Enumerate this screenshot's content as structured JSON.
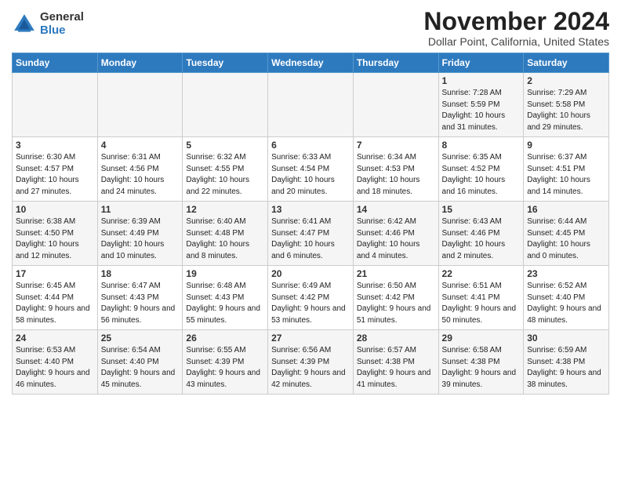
{
  "logo": {
    "general": "General",
    "blue": "Blue"
  },
  "title": "November 2024",
  "location": "Dollar Point, California, United States",
  "days_of_week": [
    "Sunday",
    "Monday",
    "Tuesday",
    "Wednesday",
    "Thursday",
    "Friday",
    "Saturday"
  ],
  "weeks": [
    [
      {
        "num": "",
        "info": ""
      },
      {
        "num": "",
        "info": ""
      },
      {
        "num": "",
        "info": ""
      },
      {
        "num": "",
        "info": ""
      },
      {
        "num": "",
        "info": ""
      },
      {
        "num": "1",
        "info": "Sunrise: 7:28 AM\nSunset: 5:59 PM\nDaylight: 10 hours and 31 minutes."
      },
      {
        "num": "2",
        "info": "Sunrise: 7:29 AM\nSunset: 5:58 PM\nDaylight: 10 hours and 29 minutes."
      }
    ],
    [
      {
        "num": "3",
        "info": "Sunrise: 6:30 AM\nSunset: 4:57 PM\nDaylight: 10 hours and 27 minutes."
      },
      {
        "num": "4",
        "info": "Sunrise: 6:31 AM\nSunset: 4:56 PM\nDaylight: 10 hours and 24 minutes."
      },
      {
        "num": "5",
        "info": "Sunrise: 6:32 AM\nSunset: 4:55 PM\nDaylight: 10 hours and 22 minutes."
      },
      {
        "num": "6",
        "info": "Sunrise: 6:33 AM\nSunset: 4:54 PM\nDaylight: 10 hours and 20 minutes."
      },
      {
        "num": "7",
        "info": "Sunrise: 6:34 AM\nSunset: 4:53 PM\nDaylight: 10 hours and 18 minutes."
      },
      {
        "num": "8",
        "info": "Sunrise: 6:35 AM\nSunset: 4:52 PM\nDaylight: 10 hours and 16 minutes."
      },
      {
        "num": "9",
        "info": "Sunrise: 6:37 AM\nSunset: 4:51 PM\nDaylight: 10 hours and 14 minutes."
      }
    ],
    [
      {
        "num": "10",
        "info": "Sunrise: 6:38 AM\nSunset: 4:50 PM\nDaylight: 10 hours and 12 minutes."
      },
      {
        "num": "11",
        "info": "Sunrise: 6:39 AM\nSunset: 4:49 PM\nDaylight: 10 hours and 10 minutes."
      },
      {
        "num": "12",
        "info": "Sunrise: 6:40 AM\nSunset: 4:48 PM\nDaylight: 10 hours and 8 minutes."
      },
      {
        "num": "13",
        "info": "Sunrise: 6:41 AM\nSunset: 4:47 PM\nDaylight: 10 hours and 6 minutes."
      },
      {
        "num": "14",
        "info": "Sunrise: 6:42 AM\nSunset: 4:46 PM\nDaylight: 10 hours and 4 minutes."
      },
      {
        "num": "15",
        "info": "Sunrise: 6:43 AM\nSunset: 4:46 PM\nDaylight: 10 hours and 2 minutes."
      },
      {
        "num": "16",
        "info": "Sunrise: 6:44 AM\nSunset: 4:45 PM\nDaylight: 10 hours and 0 minutes."
      }
    ],
    [
      {
        "num": "17",
        "info": "Sunrise: 6:45 AM\nSunset: 4:44 PM\nDaylight: 9 hours and 58 minutes."
      },
      {
        "num": "18",
        "info": "Sunrise: 6:47 AM\nSunset: 4:43 PM\nDaylight: 9 hours and 56 minutes."
      },
      {
        "num": "19",
        "info": "Sunrise: 6:48 AM\nSunset: 4:43 PM\nDaylight: 9 hours and 55 minutes."
      },
      {
        "num": "20",
        "info": "Sunrise: 6:49 AM\nSunset: 4:42 PM\nDaylight: 9 hours and 53 minutes."
      },
      {
        "num": "21",
        "info": "Sunrise: 6:50 AM\nSunset: 4:42 PM\nDaylight: 9 hours and 51 minutes."
      },
      {
        "num": "22",
        "info": "Sunrise: 6:51 AM\nSunset: 4:41 PM\nDaylight: 9 hours and 50 minutes."
      },
      {
        "num": "23",
        "info": "Sunrise: 6:52 AM\nSunset: 4:40 PM\nDaylight: 9 hours and 48 minutes."
      }
    ],
    [
      {
        "num": "24",
        "info": "Sunrise: 6:53 AM\nSunset: 4:40 PM\nDaylight: 9 hours and 46 minutes."
      },
      {
        "num": "25",
        "info": "Sunrise: 6:54 AM\nSunset: 4:40 PM\nDaylight: 9 hours and 45 minutes."
      },
      {
        "num": "26",
        "info": "Sunrise: 6:55 AM\nSunset: 4:39 PM\nDaylight: 9 hours and 43 minutes."
      },
      {
        "num": "27",
        "info": "Sunrise: 6:56 AM\nSunset: 4:39 PM\nDaylight: 9 hours and 42 minutes."
      },
      {
        "num": "28",
        "info": "Sunrise: 6:57 AM\nSunset: 4:38 PM\nDaylight: 9 hours and 41 minutes."
      },
      {
        "num": "29",
        "info": "Sunrise: 6:58 AM\nSunset: 4:38 PM\nDaylight: 9 hours and 39 minutes."
      },
      {
        "num": "30",
        "info": "Sunrise: 6:59 AM\nSunset: 4:38 PM\nDaylight: 9 hours and 38 minutes."
      }
    ]
  ]
}
